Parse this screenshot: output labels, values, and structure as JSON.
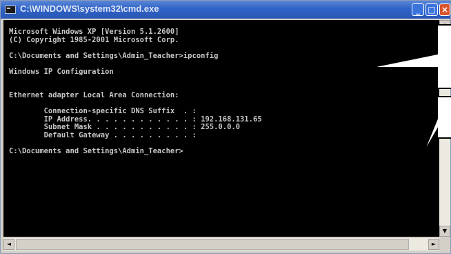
{
  "window": {
    "title": "C:\\WINDOWS\\system32\\cmd.exe",
    "minimize_glyph": "_",
    "maximize_glyph": "□",
    "close_glyph": "×"
  },
  "console": {
    "banner_line1": "Microsoft Windows XP [Version 5.1.2600]",
    "banner_line2": "(C) Copyright 1985-2001 Microsoft Corp.",
    "prompt_command": "C:\\Documents and Settings\\Admin_Teacher>ipconfig",
    "heading": "Windows IP Configuration",
    "adapter": "Ethernet adapter Local Area Connection:",
    "dns_suffix_line": "        Connection-specific DNS Suffix  . :",
    "ip_address_line": "        IP Address. . . . . . . . . . . . : 192.168.131.65",
    "subnet_mask_line": "        Subnet Mask . . . . . . . . . . . : 255.0.0.0",
    "default_gateway_line": "        Default Gateway . . . . . . . . . :",
    "final_prompt": "C:\\Documents and Settings\\Admin_Teacher>"
  },
  "scrollbars": {
    "up_arrow": "▲",
    "down_arrow": "▼",
    "left_arrow": "◄",
    "right_arrow": "►"
  },
  "colors": {
    "console_bg": "#000000",
    "console_text": "#c8c8c8",
    "titlebar": "#2f63c8",
    "callout_border": "#000000",
    "callout_fill": "#ffffff"
  }
}
